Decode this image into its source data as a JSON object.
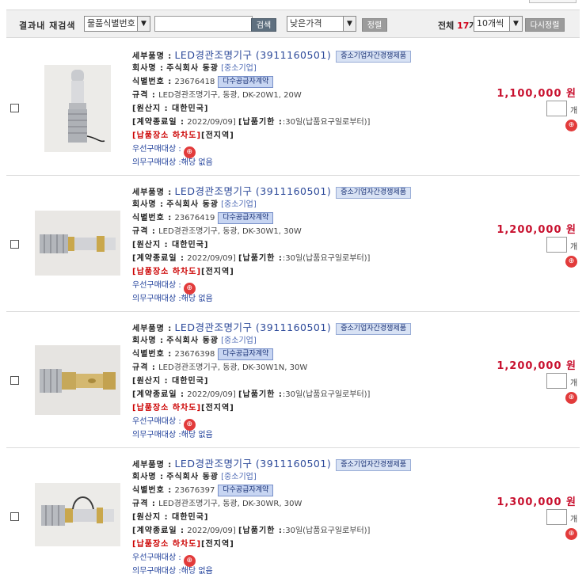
{
  "search": {
    "label": "결과내 재검색",
    "field_select": "물품식별번호",
    "input_value": "",
    "search_button": "검색",
    "sort_select": "낮은가격",
    "sort_button": "정렬",
    "total_label": "전체",
    "total_count": "17",
    "total_unit": "개",
    "perpage_select": "10개씩",
    "reorder_button": "다시정렬"
  },
  "labels": {
    "product": "세부품명 :",
    "company": "회사명 :",
    "id": "식별번호 :",
    "spec": "규격 :",
    "origin": "[원산지 : 대한민국]",
    "contract": "[계약종료일 :",
    "delivery": "[납품기한 :",
    "place": "[납품장소 하차도]",
    "place_value": "[전지역]",
    "priority": "우선구매대상 :",
    "mandatory": "의무구매대상 :",
    "mandatory_value": "해당 없음",
    "qty_unit": "개",
    "gov_icon": "⊕"
  },
  "items": [
    {
      "product_name": "LED경관조명기구 (3911160501)",
      "badge_competition": "중소기업자간경쟁제품",
      "company": "주식회사 동광",
      "company_type": "[중소기업]",
      "id": "23676418",
      "badge_contract": "다수공급자계약",
      "spec": "LED경관조명기구, 동광, DK-20W1, 20W",
      "contract_end": "2022/09/09]",
      "delivery": ":30일(납품요구일로부터)]",
      "price": "1,100,000 원",
      "qty": ""
    },
    {
      "product_name": "LED경관조명기구 (3911160501)",
      "badge_competition": "중소기업자간경쟁제품",
      "company": "주식회사 동광",
      "company_type": "[중소기업]",
      "id": "23676419",
      "badge_contract": "다수공급자계약",
      "spec": "LED경관조명기구, 동광, DK-30W1, 30W",
      "contract_end": "2022/09/09]",
      "delivery": ":30일(납품요구일로부터)]",
      "price": "1,200,000 원",
      "qty": ""
    },
    {
      "product_name": "LED경관조명기구 (3911160501)",
      "badge_competition": "중소기업자간경쟁제품",
      "company": "주식회사 동광",
      "company_type": "[중소기업]",
      "id": "23676398",
      "badge_contract": "다수공급자계약",
      "spec": "LED경관조명기구, 동광, DK-30W1N, 30W",
      "contract_end": "2022/09/09]",
      "delivery": ":30일(납품요구일로부터)]",
      "price": "1,200,000 원",
      "qty": ""
    },
    {
      "product_name": "LED경관조명기구 (3911160501)",
      "badge_competition": "중소기업자간경쟁제품",
      "company": "주식회사 동광",
      "company_type": "[중소기업]",
      "id": "23676397",
      "badge_contract": "다수공급자계약",
      "spec": "LED경관조명기구, 동광, DK-30WR, 30W",
      "contract_end": "2022/09/09]",
      "delivery": ":30일(납품요구일로부터)]",
      "price": "1,300,000 원",
      "qty": ""
    }
  ]
}
